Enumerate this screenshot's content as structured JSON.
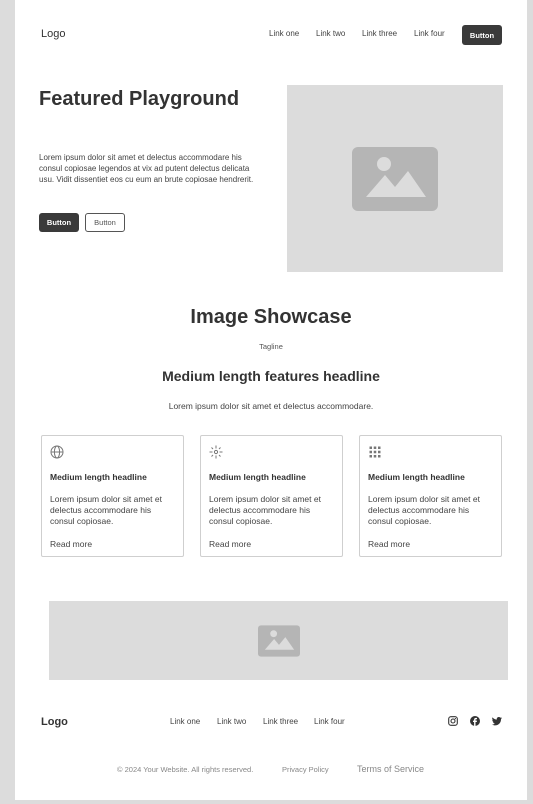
{
  "header": {
    "logo": "Logo",
    "nav": [
      "Link one",
      "Link two",
      "Link three",
      "Link four"
    ],
    "button": "Button"
  },
  "hero": {
    "title": "Featured Playground",
    "text": "Lorem ipsum dolor sit amet et delectus accommodare his consul copiosae legendos at vix ad putent delectus delicata usu. Vidit dissentiet eos cu eum an brute copiosae hendrerit.",
    "primary_button": "Button",
    "secondary_button": "Button"
  },
  "showcase": {
    "title": "Image Showcase",
    "tagline": "Tagline",
    "headline": "Medium length features headline",
    "subtext": "Lorem ipsum dolor sit amet et delectus accommodare."
  },
  "cards": [
    {
      "icon": "globe-icon",
      "headline": "Medium length headline",
      "body": "Lorem ipsum dolor sit amet et delectus accommodare his consul copiosae.",
      "link": "Read more"
    },
    {
      "icon": "sparkle-icon",
      "headline": "Medium length headline",
      "body": "Lorem ipsum dolor sit amet et delectus accommodare his consul copiosae.",
      "link": "Read more"
    },
    {
      "icon": "grid-dots-icon",
      "headline": "Medium length headline",
      "body": "Lorem ipsum dolor sit amet et delectus accommodare his consul copiosae.",
      "link": "Read more"
    }
  ],
  "footer": {
    "logo": "Logo",
    "nav": [
      "Link one",
      "Link two",
      "Link three",
      "Link four"
    ],
    "social": [
      "instagram-icon",
      "facebook-icon",
      "twitter-icon"
    ],
    "copyright": "© 2024 Your Website. All rights reserved.",
    "privacy": "Privacy Policy",
    "terms": "Terms of Service"
  },
  "colors": {
    "background": "#dcdcdc",
    "dark_button": "#3a3a3a",
    "placeholder": "#dcdcdc",
    "placeholder_icon": "#b5b5b5"
  }
}
